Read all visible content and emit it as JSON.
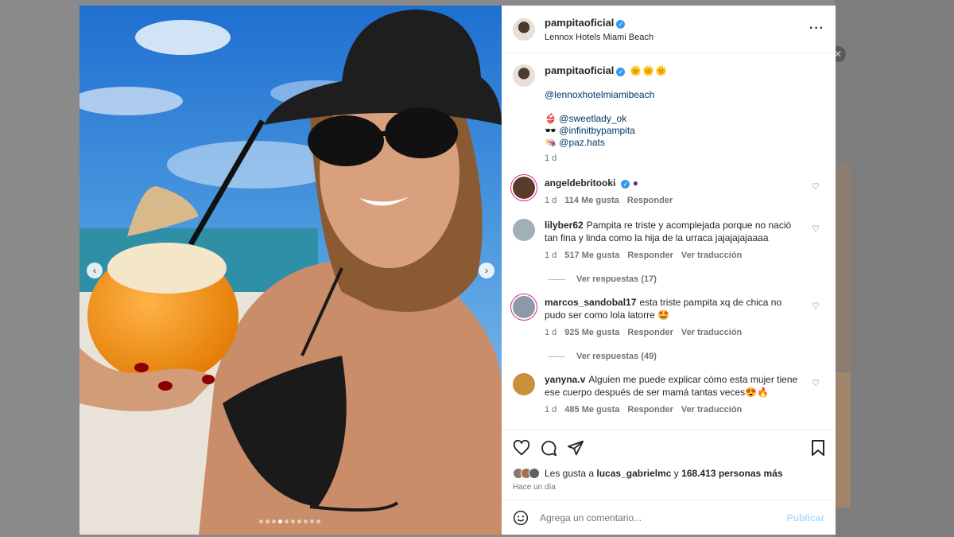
{
  "header": {
    "username": "pampitaoficial",
    "location": "Lennox Hotels Miami Beach"
  },
  "caption": {
    "username": "pampitaoficial",
    "emojis": "🌞🌞🌞",
    "mention_hotel": "@lennoxhotelmiamibeach",
    "credits": [
      {
        "emoji": "👙",
        "handle": "@sweetlady_ok"
      },
      {
        "emoji": "🕶️",
        "handle": "@infinitbypampita"
      },
      {
        "emoji": "👒",
        "handle": "@paz.hats"
      }
    ],
    "time": "1 d"
  },
  "comments": [
    {
      "username": "angeldebritooki",
      "text": "",
      "time": "1 d",
      "likes": "114 Me gusta",
      "reply": "Responder",
      "translate": ""
    },
    {
      "username": "lilyber62",
      "text": "Pampita re triste y acomplejada porque no nació tan fina y linda como la hija de la urraca jajajajajaaaa",
      "time": "1 d",
      "likes": "517 Me gusta",
      "reply": "Responder",
      "translate": "Ver traducción",
      "view_replies": "Ver respuestas (17)"
    },
    {
      "username": "marcos_sandobal17",
      "text": "esta triste pampita xq de chica no pudo ser como lola latorre 🤩",
      "time": "1 d",
      "likes": "925 Me gusta",
      "reply": "Responder",
      "translate": "Ver traducción",
      "view_replies": "Ver respuestas (49)"
    },
    {
      "username": "yanyna.v",
      "text": "Alguien me puede explicar cómo esta mujer tiene ese cuerpo después de ser mamá tantas veces😍🔥",
      "time": "1 d",
      "likes": "485 Me gusta",
      "reply": "Responder",
      "translate": "Ver traducción"
    }
  ],
  "likes": {
    "prefix": "Les gusta a",
    "user": "lucas_gabrielmc",
    "connector": "y",
    "others": "168.413 personas más"
  },
  "posted": "Hace un día",
  "composer": {
    "placeholder": "Agrega un comentario...",
    "publish": "Publicar"
  },
  "carousel": {
    "total": 10,
    "current": 3
  },
  "colors": {
    "link": "#00376b",
    "verified": "#3897f0",
    "publish_disabled": "#b3dbff"
  },
  "icons": [
    "more-icon",
    "heart-icon",
    "comment-icon",
    "share-icon",
    "bookmark-icon",
    "emoji-icon",
    "chevron-left-icon",
    "chevron-right-icon"
  ]
}
